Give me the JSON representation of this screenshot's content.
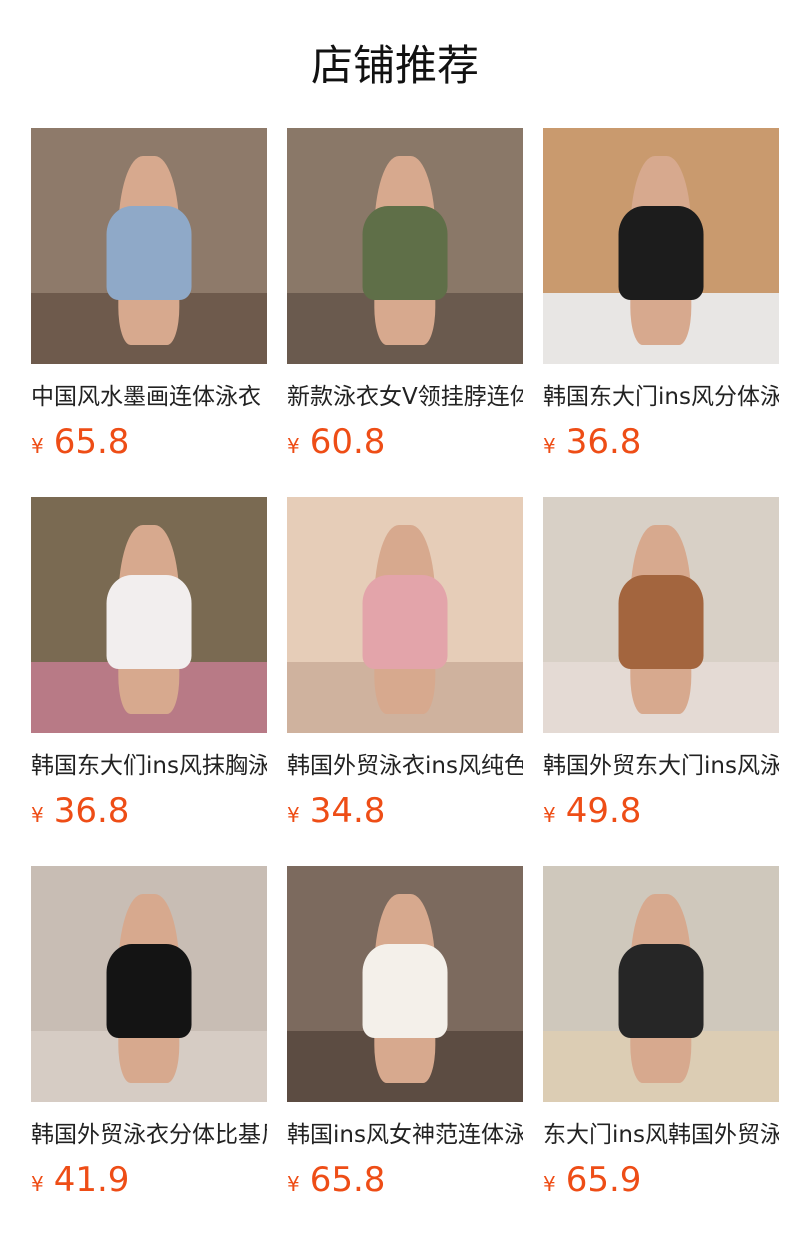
{
  "page": {
    "title": "店铺推荐"
  },
  "products": [
    {
      "name": "中国风水墨画连体泳衣",
      "currency": "¥",
      "price": "65.8",
      "colors": {
        "bg": "#8e7a6a",
        "floor": "#6e5a4c",
        "garment": "#8fa9c8"
      }
    },
    {
      "name": "新款泳衣女V领挂脖连体",
      "currency": "¥",
      "price": "60.8",
      "colors": {
        "bg": "#8a7868",
        "floor": "#6a5a4e",
        "garment": "#5f6f48"
      }
    },
    {
      "name": "韩国东大门ins风分体泳衣",
      "currency": "¥",
      "price": "36.8",
      "colors": {
        "bg": "#c99a6e",
        "floor": "#e8e6e4",
        "garment": "#1c1c1c"
      }
    },
    {
      "name": "韩国东大们ins风抹胸泳衣",
      "currency": "¥",
      "price": "36.8",
      "colors": {
        "bg": "#7a6a52",
        "floor": "#b87a86",
        "garment": "#f2eeee"
      }
    },
    {
      "name": "韩国外贸泳衣ins风纯色",
      "currency": "¥",
      "price": "34.8",
      "colors": {
        "bg": "#e6cdb8",
        "floor": "#cfb29e",
        "garment": "#e3a4aa"
      }
    },
    {
      "name": "韩国外贸东大门ins风泳衣",
      "currency": "¥",
      "price": "49.8",
      "colors": {
        "bg": "#d8d0c6",
        "floor": "#e4dad4",
        "garment": "#a3653e"
      }
    },
    {
      "name": "韩国外贸泳衣分体比基尼",
      "currency": "¥",
      "price": "41.9",
      "colors": {
        "bg": "#c8bdb4",
        "floor": "#d6ccc4",
        "garment": "#141414"
      }
    },
    {
      "name": "韩国ins风女神范连体泳衣",
      "currency": "¥",
      "price": "65.8",
      "colors": {
        "bg": "#7c6a5e",
        "floor": "#5c4c42",
        "garment": "#f4f0ea"
      }
    },
    {
      "name": "东大门ins风韩国外贸泳衣",
      "currency": "¥",
      "price": "65.9",
      "colors": {
        "bg": "#cfc8bc",
        "floor": "#dccdb4",
        "garment": "#262626"
      }
    }
  ]
}
